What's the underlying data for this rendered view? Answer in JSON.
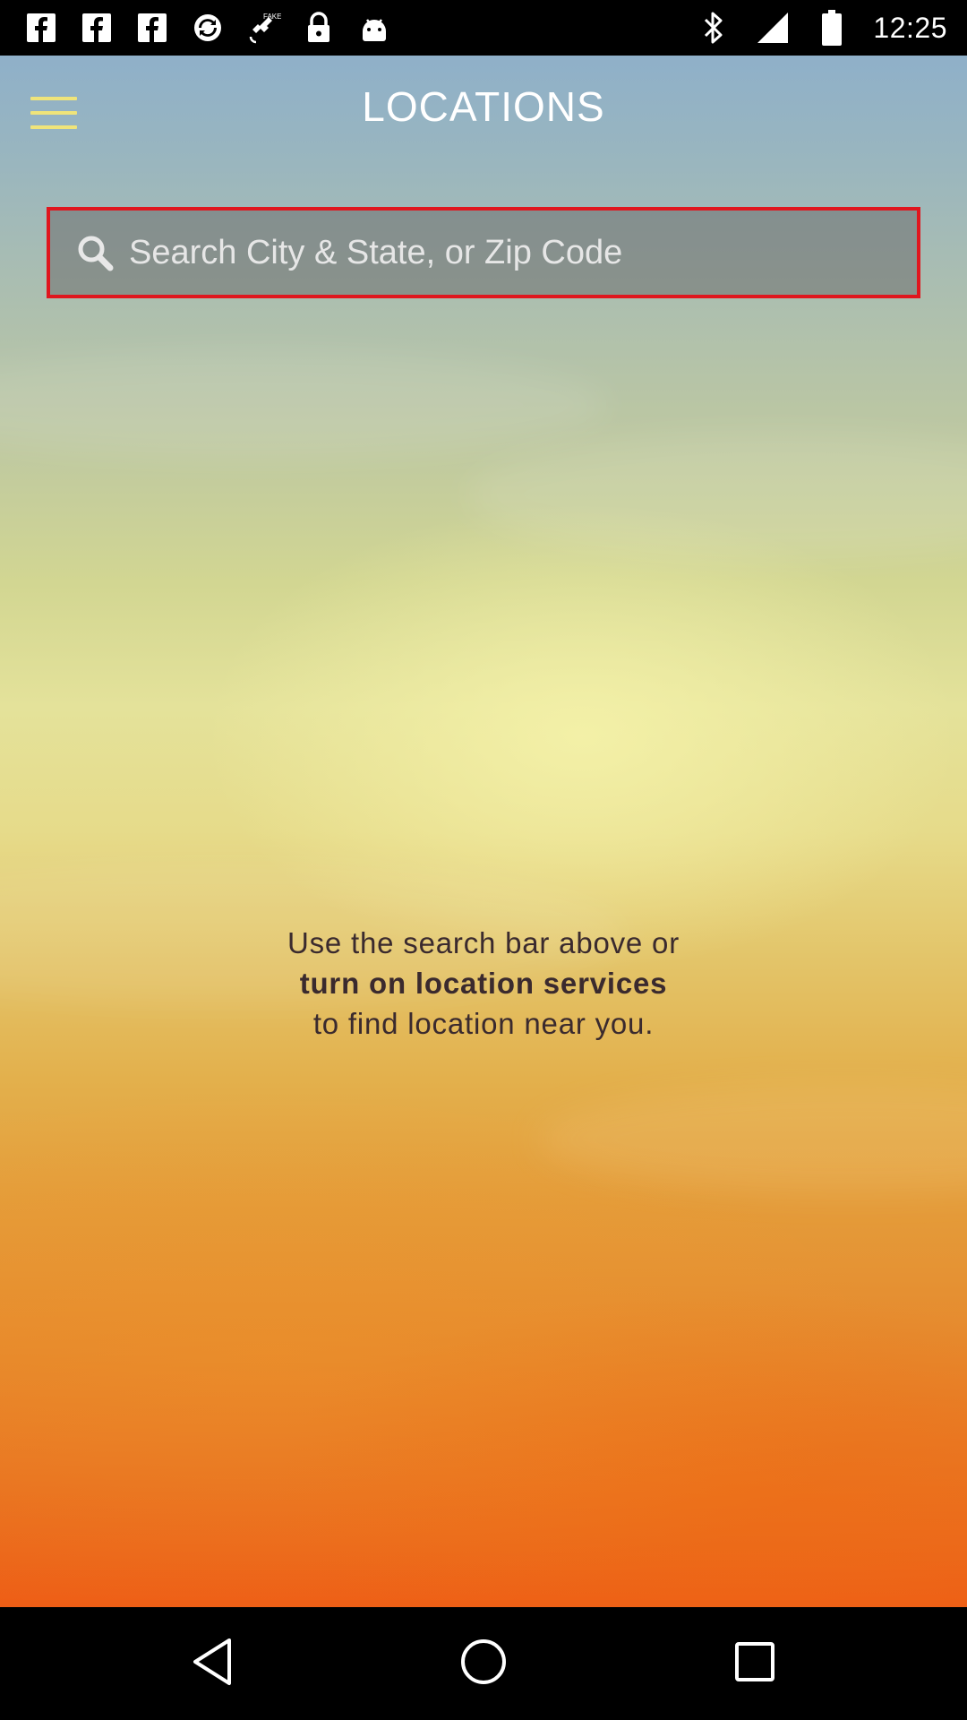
{
  "status_bar": {
    "time": "12:25",
    "left_icons": [
      "facebook-icon",
      "facebook-icon",
      "facebook-icon",
      "sync-icon",
      "satellite-fake-gps-icon",
      "lock-icon",
      "android-icon"
    ],
    "right_icons": [
      "bluetooth-icon",
      "signal-icon",
      "battery-icon"
    ]
  },
  "header": {
    "title": "LOCATIONS",
    "menu_icon": "hamburger-menu-icon",
    "menu_color": "#efe47a"
  },
  "search": {
    "placeholder": "Search City & State, or Zip Code",
    "value": "",
    "icon": "search-icon",
    "border_color": "#e0161e"
  },
  "message": {
    "line1": "Use the search bar above or",
    "line2": "turn on location services",
    "line3": "to find location near you."
  },
  "nav_bar": {
    "back": "back-icon",
    "home": "home-icon",
    "recents": "recents-icon"
  }
}
